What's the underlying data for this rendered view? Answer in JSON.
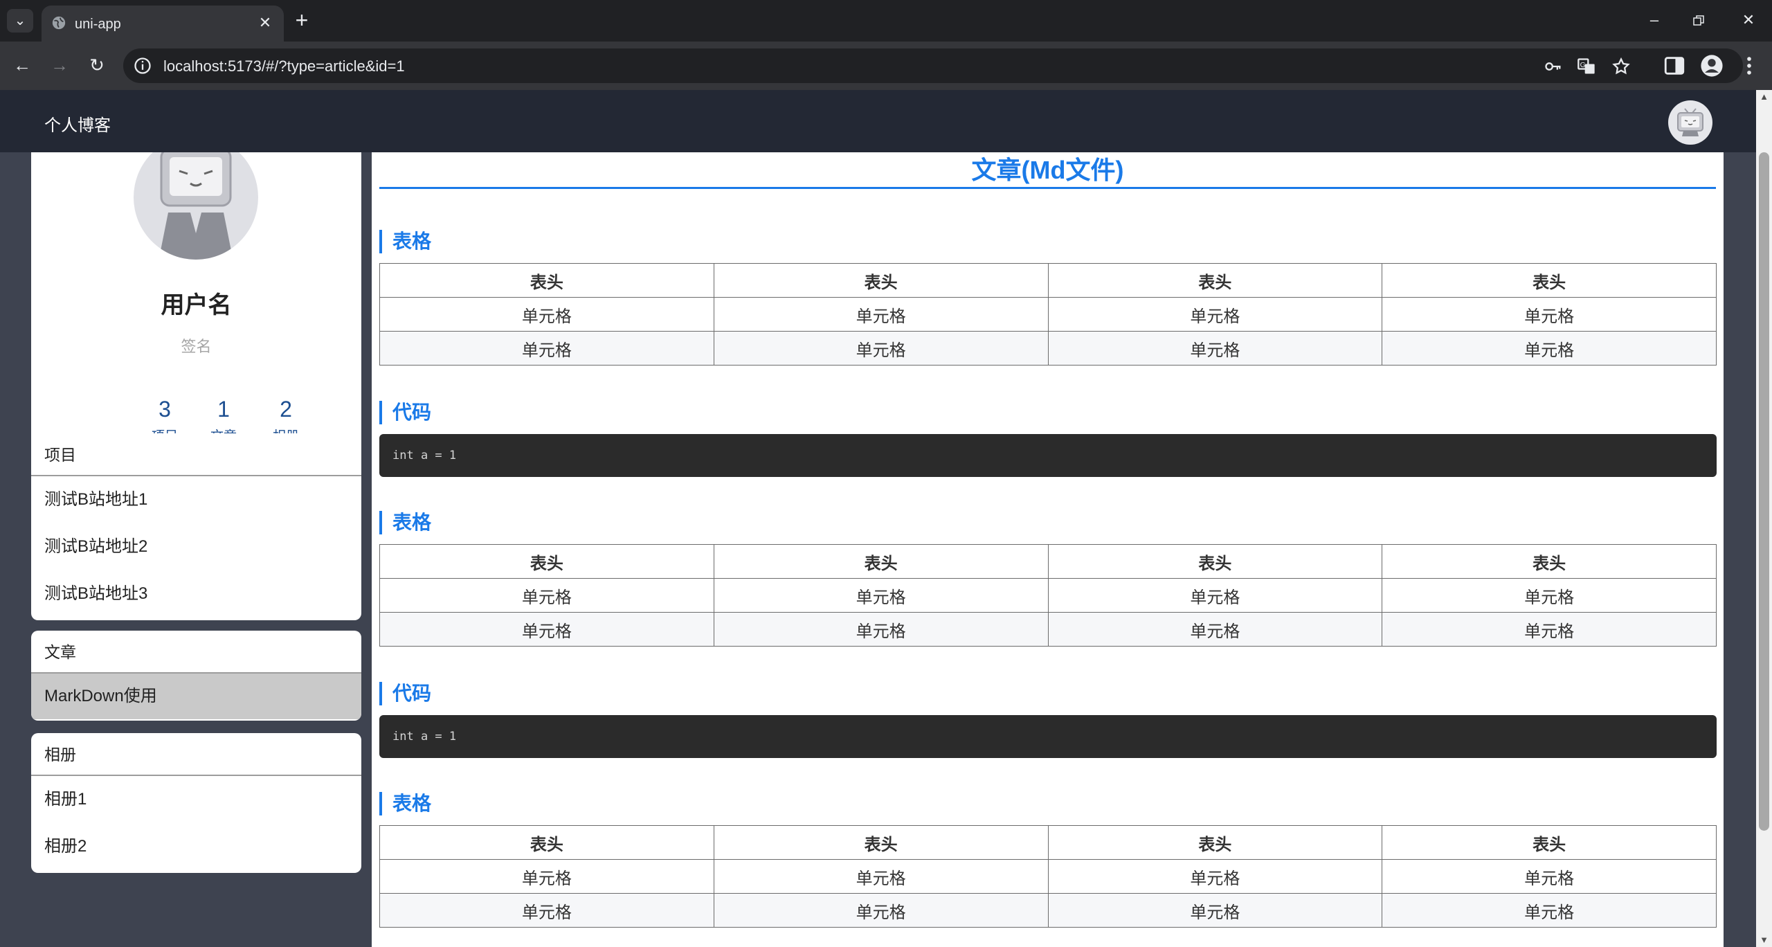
{
  "browser": {
    "tab_title": "uni-app",
    "url": "localhost:5173/#/?type=article&id=1",
    "icons": [
      "tab-list-icon",
      "globe-icon",
      "close-icon",
      "plus-icon",
      "minimize-icon",
      "restore-icon",
      "window-close-icon",
      "back-icon",
      "forward-icon",
      "reload-icon",
      "site-info-icon",
      "password-key-icon",
      "translate-icon",
      "bookmark-star-icon",
      "side-panel-icon",
      "profile-icon",
      "more-vert-icon"
    ]
  },
  "app": {
    "title": "个人博客"
  },
  "profile": {
    "name": "用户名",
    "signature": "签名",
    "stats": [
      {
        "count": "3",
        "label": "项目"
      },
      {
        "count": "1",
        "label": "文章"
      },
      {
        "count": "2",
        "label": "相册"
      }
    ]
  },
  "projects": {
    "header": "项目",
    "items": [
      "测试B站地址1",
      "测试B站地址2",
      "测试B站地址3"
    ]
  },
  "articles": {
    "header": "文章",
    "items": [
      "MarkDown使用"
    ],
    "active_index": 0
  },
  "albums": {
    "header": "相册",
    "items": [
      "相册1",
      "相册2"
    ]
  },
  "article": {
    "title": "文章(Md文件)",
    "sections": [
      {
        "type": "table",
        "heading": "表格",
        "headers": [
          "表头",
          "表头",
          "表头",
          "表头"
        ],
        "rows": [
          [
            "单元格",
            "单元格",
            "单元格",
            "单元格"
          ],
          [
            "单元格",
            "单元格",
            "单元格",
            "单元格"
          ]
        ]
      },
      {
        "type": "code",
        "heading": "代码",
        "code": "int a = 1"
      },
      {
        "type": "table",
        "heading": "表格",
        "headers": [
          "表头",
          "表头",
          "表头",
          "表头"
        ],
        "rows": [
          [
            "单元格",
            "单元格",
            "单元格",
            "单元格"
          ],
          [
            "单元格",
            "单元格",
            "单元格",
            "单元格"
          ]
        ]
      },
      {
        "type": "code",
        "heading": "代码",
        "code": "int a = 1"
      },
      {
        "type": "table",
        "heading": "表格",
        "headers": [
          "表头",
          "表头",
          "表头",
          "表头"
        ],
        "rows": [
          [
            "单元格",
            "单元格",
            "单元格",
            "单元格"
          ],
          [
            "单元格",
            "单元格",
            "单元格",
            "单元格"
          ]
        ]
      }
    ]
  },
  "colors": {
    "accent": "#1a7ae8",
    "appbar": "#232834",
    "page_bg": "#3e4350",
    "stat_text": "#1d4f91",
    "code_bg": "#2b2b2b",
    "active_item": "#c9c9c9"
  }
}
